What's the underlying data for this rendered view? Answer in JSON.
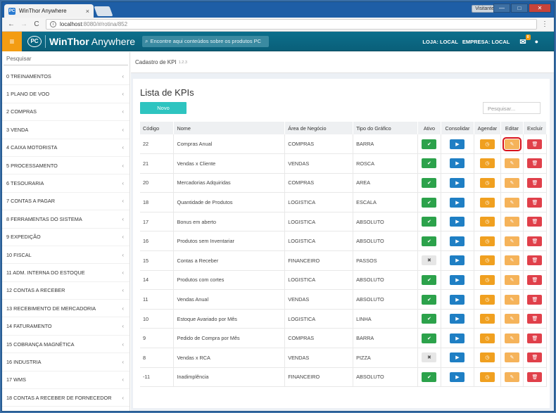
{
  "browser": {
    "tab_title": "WinThor Anywhere",
    "tab_close": "×",
    "profile_label": "Visitante",
    "url_host": "localhost",
    "url_path": ":8080/#/rotina/852",
    "window_min": "—",
    "window_max": "□",
    "window_close": "✕"
  },
  "header": {
    "brand_logo": "PC",
    "brand_name_bold": "WinThor",
    "brand_name_rest": " Anywhere",
    "search_placeholder": "Encontre aqui conteúdos sobre os produtos PC",
    "loja": "LOJA: LOCAL",
    "empresa": "EMPRESA: LOCAL",
    "mail_badge": "0"
  },
  "sidebar": {
    "search_placeholder": "Pesquisar",
    "items": [
      {
        "label": "0  TREINAMENTOS"
      },
      {
        "label": "1  PLANO DE VOO"
      },
      {
        "label": "2  COMPRAS"
      },
      {
        "label": "3  VENDA"
      },
      {
        "label": "4  CAIXA MOTORISTA"
      },
      {
        "label": "5  PROCESSAMENTO"
      },
      {
        "label": "6  TESOURARIA"
      },
      {
        "label": "7  CONTAS A PAGAR"
      },
      {
        "label": "8  FERRAMENTAS DO SISTEMA"
      },
      {
        "label": "9  EXPEDIÇÃO"
      },
      {
        "label": "10  FISCAL"
      },
      {
        "label": "11  ADM. INTERNA DO ESTOQUE"
      },
      {
        "label": "12  CONTAS A RECEBER"
      },
      {
        "label": "13  RECEBIMENTO DE MERCADORIA"
      },
      {
        "label": "14  FATURAMENTO"
      },
      {
        "label": "15  COBRANÇA MAGNÉTICA"
      },
      {
        "label": "16  INDUSTRIA"
      },
      {
        "label": "17  WMS"
      },
      {
        "label": "18  CONTAS A RECEBER DE FORNECEDOR"
      }
    ]
  },
  "breadcrumb": {
    "title": "Cadastro de KPI",
    "version": "1.2.3"
  },
  "main": {
    "title": "Lista de KPIs",
    "new_button": "Novo",
    "search_placeholder": "Pesquisar...",
    "columns": [
      "Código",
      "Nome",
      "Área de Negócio",
      "Tipo do Gráfico",
      "Ativo",
      "Consolidar",
      "Agendar",
      "Editar",
      "Excluir"
    ],
    "rows": [
      {
        "code": "22",
        "name": "Compras Anual",
        "area": "COMPRAS",
        "chart": "BARRA",
        "active": true
      },
      {
        "code": "21",
        "name": "Vendas x Cliente",
        "area": "VENDAS",
        "chart": "ROSCA",
        "active": true
      },
      {
        "code": "20",
        "name": "Mercadorias Adquiridas",
        "area": "COMPRAS",
        "chart": "AREA",
        "active": true
      },
      {
        "code": "18",
        "name": "Quantidade de Produtos",
        "area": "LOGISTICA",
        "chart": "ESCALA",
        "active": true
      },
      {
        "code": "17",
        "name": "Bonus em aberto",
        "area": "LOGISTICA",
        "chart": "ABSOLUTO",
        "active": true
      },
      {
        "code": "16",
        "name": "Produtos sem Inventariar",
        "area": "LOGISTICA",
        "chart": "ABSOLUTO",
        "active": true
      },
      {
        "code": "15",
        "name": "Contas a Receber",
        "area": "FINANCEIRO",
        "chart": "PASSOS",
        "active": false
      },
      {
        "code": "14",
        "name": "Produtos com cortes",
        "area": "LOGISTICA",
        "chart": "ABSOLUTO",
        "active": true
      },
      {
        "code": "11",
        "name": "Vendas Anual",
        "area": "VENDAS",
        "chart": "ABSOLUTO",
        "active": true
      },
      {
        "code": "10",
        "name": "Estoque Avariado por Mês",
        "area": "LOGISTICA",
        "chart": "LINHA",
        "active": true
      },
      {
        "code": "9",
        "name": "Pedido de Compra por Mês",
        "area": "COMPRAS",
        "chart": "BARRA",
        "active": true
      },
      {
        "code": "8",
        "name": "Vendas x RCA",
        "area": "VENDAS",
        "chart": "PIZZA",
        "active": false
      },
      {
        "code": "-11",
        "name": "Inadimplência",
        "area": "FINANCEIRO",
        "chart": "ABSOLUTO",
        "active": true
      }
    ]
  },
  "colors": {
    "header": "#0a6a86",
    "accent_orange": "#f39c12",
    "novo_button": "#2ec4c0",
    "active_green": "#2ca24b",
    "consolidate_blue": "#1f7fc4",
    "schedule_orange": "#f0a020",
    "delete_red": "#e0404a",
    "highlight_red": "#d8121b"
  },
  "icons": {
    "active": "check-icon",
    "inactive": "x-icon",
    "consolidate": "play-icon",
    "schedule": "clock-icon",
    "edit": "edit-icon",
    "delete": "trash-icon"
  }
}
